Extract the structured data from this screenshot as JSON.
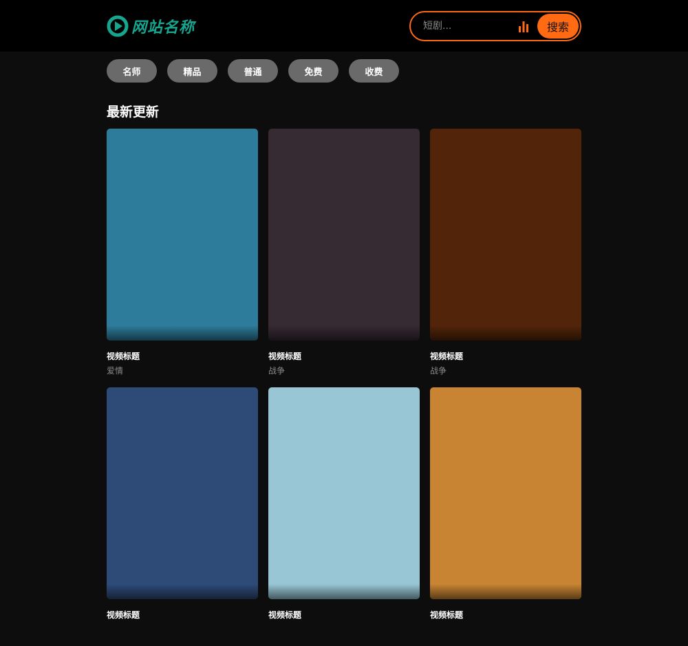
{
  "header": {
    "logo_text": "网站名称",
    "search": {
      "placeholder": "短剧...",
      "button_label": "搜索"
    }
  },
  "colors": {
    "accent": "#ff6a13",
    "logo": "#16a58f"
  },
  "tags": [
    "名师",
    "精品",
    "普通",
    "免费",
    "收费"
  ],
  "section": {
    "title": "最新更新"
  },
  "videos": [
    {
      "title": "视频标题",
      "genre": "爱情",
      "color": "#2e7c9b"
    },
    {
      "title": "视频标题",
      "genre": "战争",
      "color": "#362a33"
    },
    {
      "title": "视频标题",
      "genre": "战争",
      "color": "#52250a"
    },
    {
      "title": "视频标题",
      "genre": "",
      "color": "#2e4a77"
    },
    {
      "title": "视频标题",
      "genre": "",
      "color": "#98c6d4"
    },
    {
      "title": "视频标题",
      "genre": "",
      "color": "#c88432"
    }
  ]
}
